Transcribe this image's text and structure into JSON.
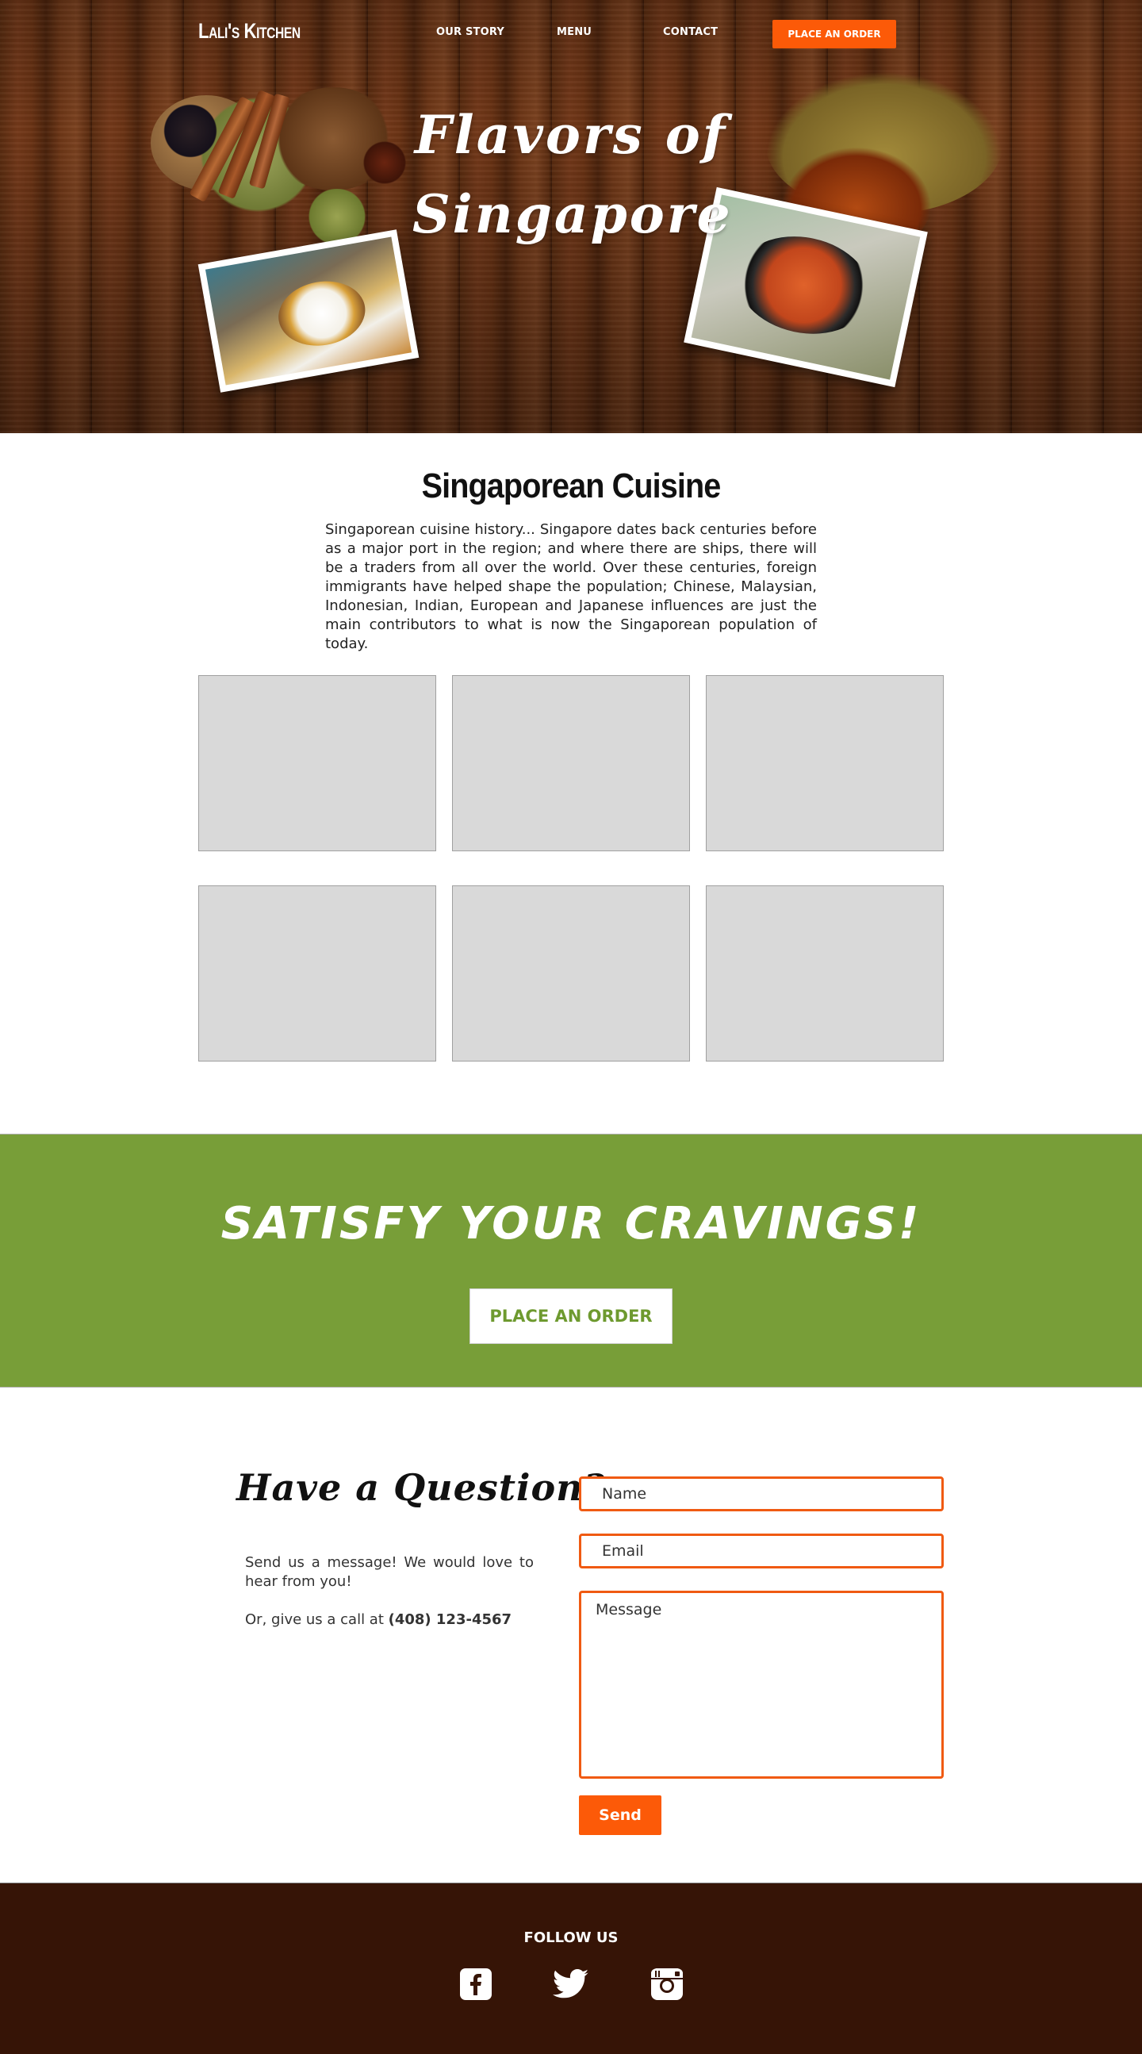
{
  "nav": {
    "logo": "Lali's Kitchen",
    "links": [
      {
        "label": "OUR STORY"
      },
      {
        "label": "MENU"
      },
      {
        "label": "CONTACT"
      }
    ],
    "cta_label": "PLACE AN ORDER"
  },
  "hero": {
    "title_line1": "Flavors of",
    "title_line2": "Singapore"
  },
  "cuisine": {
    "title": "Singaporean Cuisine",
    "text": "Singaporean cuisine history... Singapore dates back centuries before as a major port in the region; and where there are ships, there will be a traders from all over the world. Over these centuries, foreign immigrants have helped shape the population; Chinese, Malaysian, Indonesian, Indian, European and Japanese influences are just the main contributors to what is now the Singaporean population of today."
  },
  "cta": {
    "title": "SATISFY YOUR CRAVINGS!",
    "button_label": "PLACE AN ORDER",
    "accent_color": "#789e38"
  },
  "contact": {
    "heading": "Have a Question?",
    "message_text": "Send us a message! We would love to hear from you!",
    "call_prefix": "Or, give us a call at ",
    "phone": "(408) 123-4567",
    "name_placeholder": "Name",
    "email_placeholder": "Email",
    "message_placeholder": "Message",
    "send_label": "Send"
  },
  "footer": {
    "follow_label": "FOLLOW US",
    "social_icons": [
      "facebook-icon",
      "twitter-icon",
      "instagram-icon"
    ],
    "background_color": "#361406"
  },
  "colors": {
    "brand_orange": "#fc5a08",
    "field_border": "#f05a12"
  }
}
